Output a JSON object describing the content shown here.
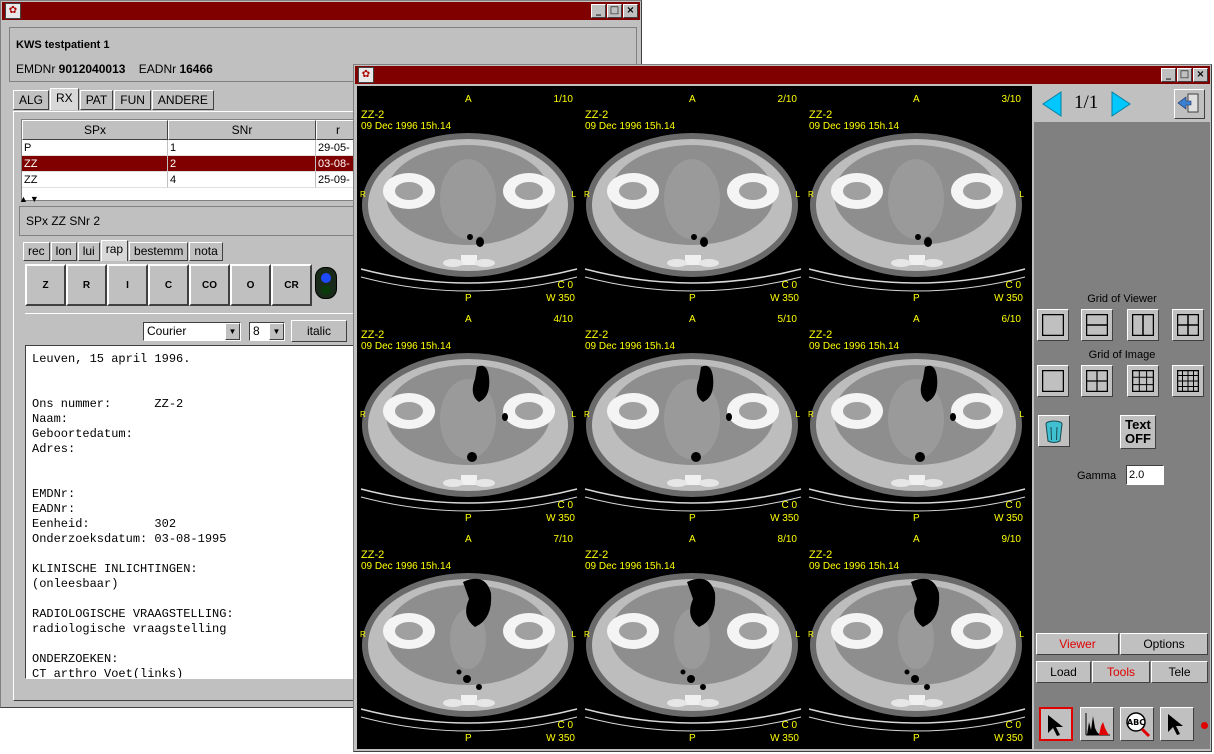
{
  "window1": {
    "patient": {
      "name": "KWS testpatient 1",
      "emdnr_label": "EMDNr",
      "emdnr": "9012040013",
      "eadnr_label": "EADNr",
      "eadnr": "16466"
    },
    "tabs": [
      "ALG",
      "RX",
      "PAT",
      "FUN",
      "ANDERE"
    ],
    "table": {
      "headers": [
        "SPx",
        "SNr",
        "r"
      ],
      "rows": [
        [
          "P",
          "1",
          "29-05-"
        ],
        [
          "ZZ",
          "2",
          "03-08-"
        ],
        [
          "ZZ",
          "4",
          "25-09-"
        ]
      ]
    },
    "subtitle": "SPx ZZ SNr 2",
    "subtabs": [
      "rec",
      "lon",
      "lui",
      "rap",
      "bestemm",
      "nota"
    ],
    "format_buttons": [
      "Z",
      "R",
      "I",
      "C",
      "CO",
      "O",
      "CR"
    ],
    "font": {
      "family": "Courier",
      "size": "8",
      "italic_label": "italic"
    },
    "report_text": "Leuven, 15 april 1996.\n\n\nOns nummer:      ZZ-2\nNaam:\nGeboortedatum:\nAdres:\n\n\nEMDNr:\nEADNr:\nEenheid:         302\nOnderzoeksdatum: 03-08-1995\n\nKLINISCHE INLICHTINGEN:\n(onleesbaar)\n\nRADIOLOGISCHE VRAAGSTELLING:\nradiologische vraagstelling\n\nONDERZOEKEN:\nCT arthro Voet(links)\nRX Teen(links)"
  },
  "viewer": {
    "series_label": "ZZ-2",
    "date_label": "09 Dec 1996 15h.14",
    "top_marker": "A",
    "bottom_marker": "P",
    "right_marker": "L",
    "left_marker": "R",
    "center_label": "C 0",
    "width_label": "W 350",
    "images": [
      "1/10",
      "2/10",
      "3/10",
      "4/10",
      "5/10",
      "6/10",
      "7/10",
      "8/10",
      "9/10"
    ]
  },
  "sidebar": {
    "page": "1/1",
    "grid_viewer_label": "Grid of Viewer",
    "grid_image_label": "Grid of Image",
    "text_toggle": [
      "Text",
      "OFF"
    ],
    "gamma_label": "Gamma",
    "gamma_value": "2.0",
    "mode_tabs": [
      "Viewer",
      "Options"
    ],
    "tool_tabs": [
      "Load",
      "Tools",
      "Tele"
    ],
    "accent": "#e00000",
    "arrow_color": "#00c8ff"
  }
}
